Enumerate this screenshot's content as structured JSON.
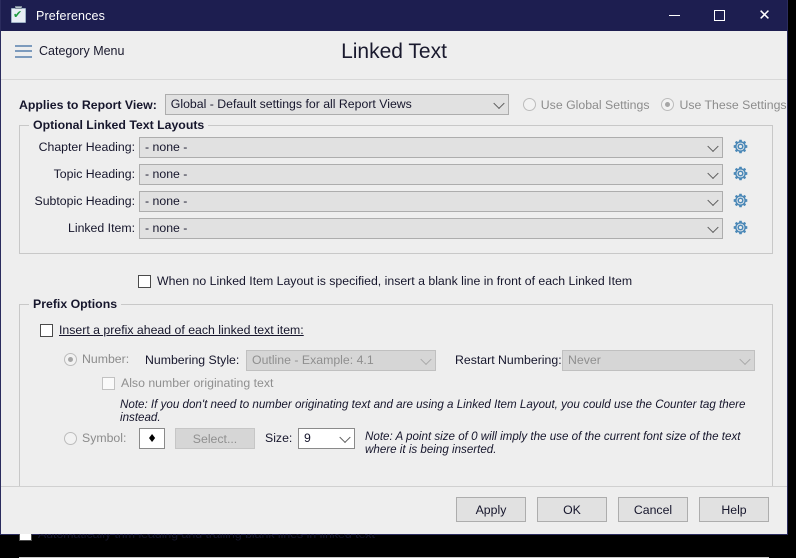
{
  "window": {
    "title": "Preferences",
    "icon": "clipboard-check-icon",
    "minimize_label": "",
    "maximize_label": "",
    "close_label": "✕",
    "accent_titlebar": "#1d1e50",
    "face_color": "#eeeeee"
  },
  "header": {
    "category_menu_label": "Category Menu",
    "page_title": "Linked Text"
  },
  "applies": {
    "label": "Applies to Report View:",
    "selected": "Global - Default settings for all Report Views",
    "options": [
      "Global - Default settings for all Report Views"
    ],
    "use_global_label": "Use Global Settings",
    "use_these_label": "Use These Settings",
    "selected_scope": "Use These Settings"
  },
  "layouts": {
    "group_title": "Optional Linked Text Layouts",
    "rows": [
      {
        "label": "Chapter Heading:",
        "value": "- none -",
        "gear": "gear-icon"
      },
      {
        "label": "Topic Heading:",
        "value": "- none -",
        "gear": "gear-icon"
      },
      {
        "label": "Subtopic Heading:",
        "value": "- none -",
        "gear": "gear-icon"
      },
      {
        "label": "Linked Item:",
        "value": "- none -",
        "gear": "gear-icon"
      }
    ],
    "blank_line_checkbox": "When no Linked Item Layout is specified, insert a blank line in front of each Linked Item",
    "blank_line_checked": false,
    "gear_color": "#4b88b7"
  },
  "prefix": {
    "group_title": "Prefix Options",
    "insert_prefix_label": "Insert a prefix ahead of each linked text item:",
    "insert_prefix_checked": false,
    "number_radio_label": "Number:",
    "number_radio_selected": true,
    "numbering_style_label": "Numbering Style:",
    "numbering_style_value": "Outline - Example: 4.1",
    "restart_numbering_label": "Restart Numbering:",
    "restart_numbering_value": "Never",
    "also_number_label": "Also number originating text",
    "also_number_checked": false,
    "note_counter": "Note: If you don't need to number originating text and are using a Linked Item Layout, you could use the Counter tag there instead.",
    "symbol_radio_label": "Symbol:",
    "symbol_radio_selected": false,
    "symbol_glyph": "♦",
    "select_button_label": "Select...",
    "size_label": "Size:",
    "size_value": "9",
    "note_size": "Note: A point size of 0 will imply the use of the current font size of the text where it is being inserted."
  },
  "trim": {
    "label": "Automatically trim leading and trailing blank lines in linked text",
    "checked": false
  },
  "footer": {
    "apply": "Apply",
    "ok": "OK",
    "cancel": "Cancel",
    "help": "Help"
  }
}
